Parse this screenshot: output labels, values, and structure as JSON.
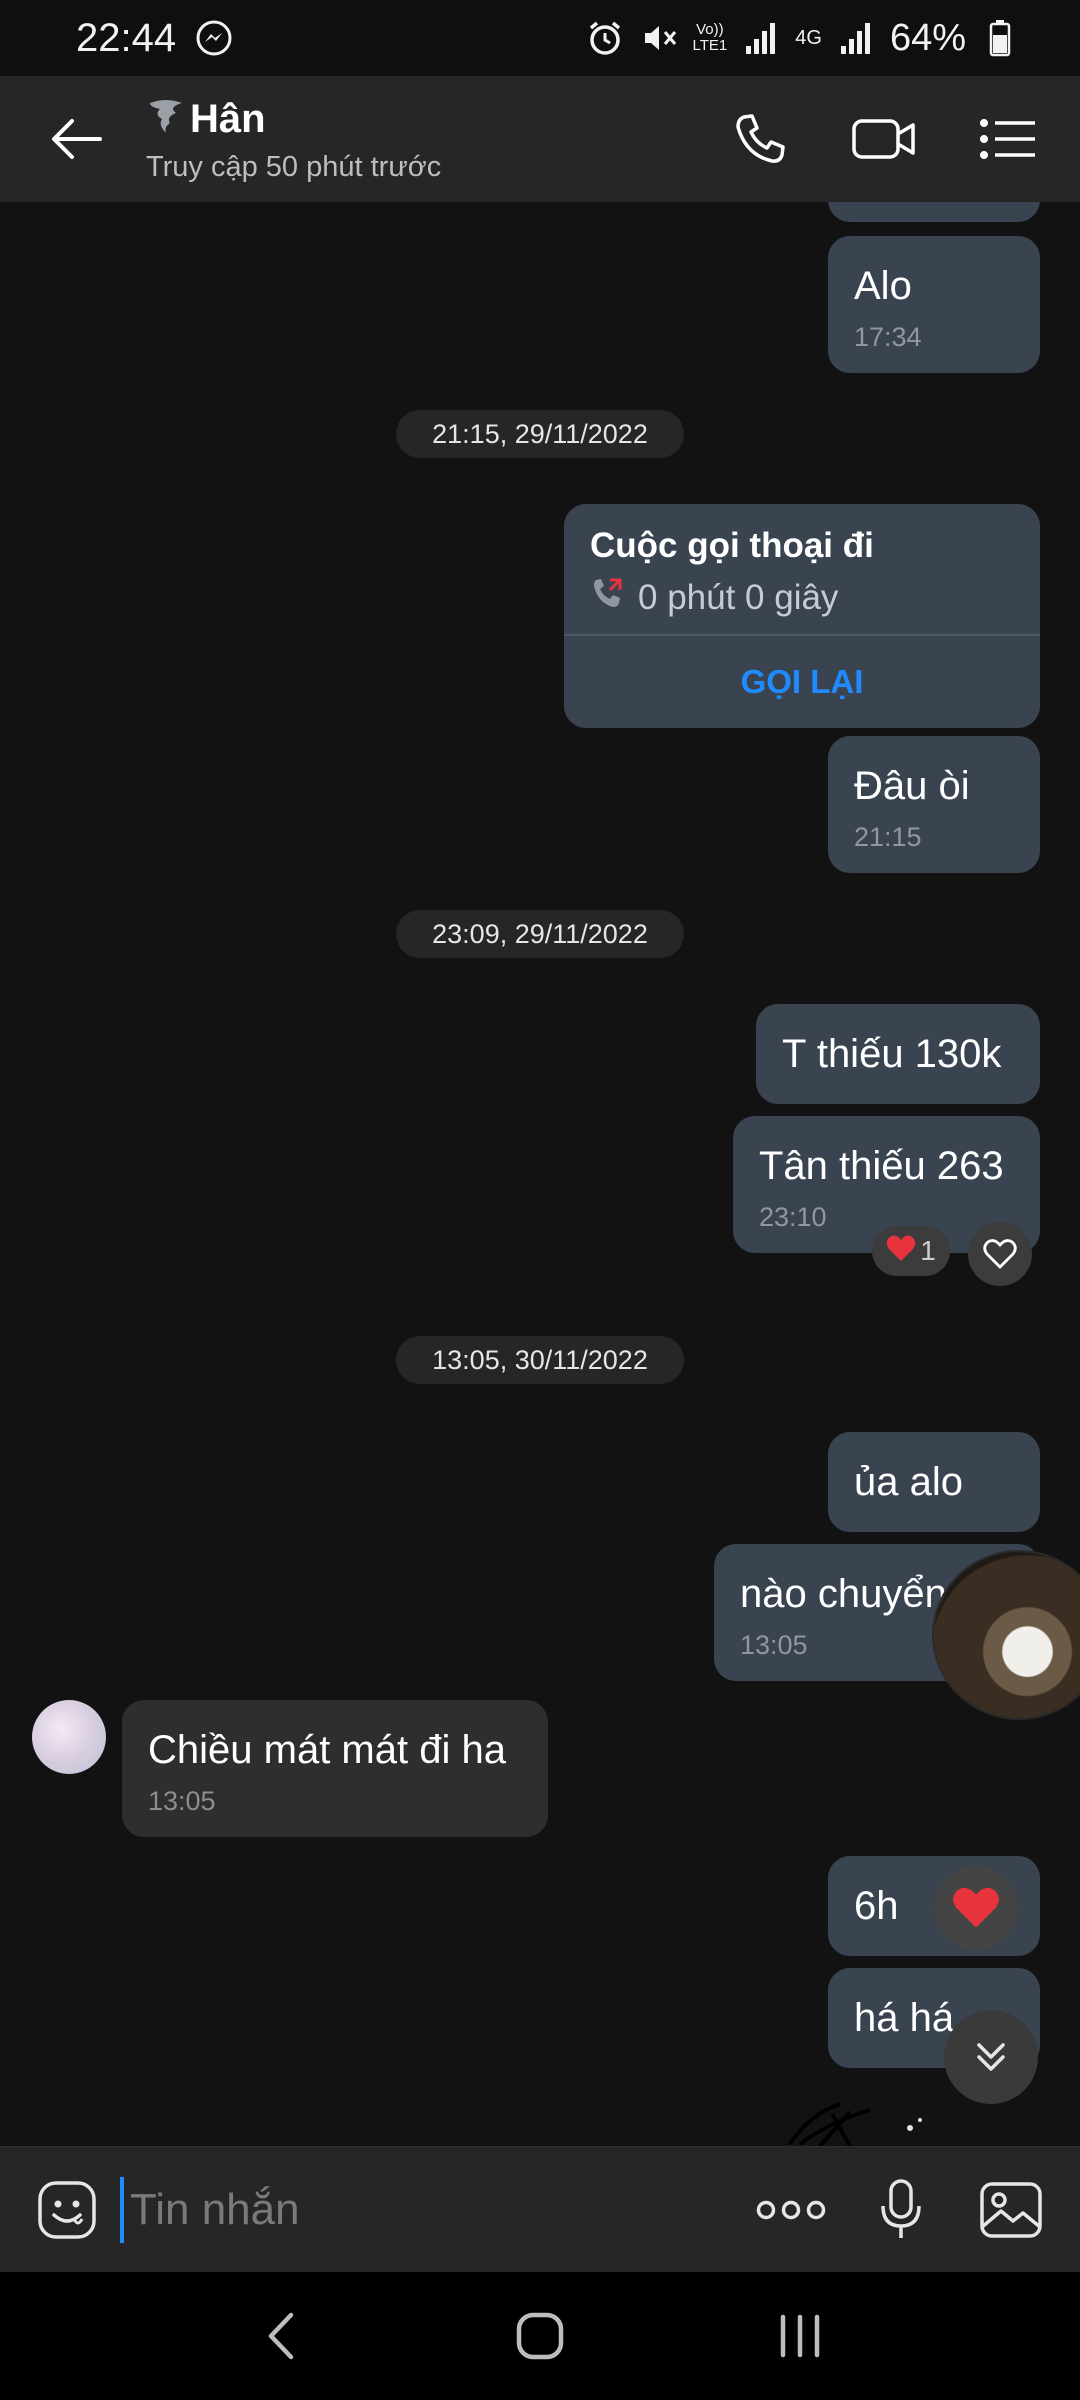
{
  "status_bar": {
    "time": "22:44",
    "volte_label_top": "Vo))",
    "volte_label_bottom": "LTE1",
    "net_4g": "4G",
    "battery": "64%"
  },
  "header": {
    "contact_name": "Hân",
    "last_seen": "Truy cập 50 phút trước"
  },
  "chat": {
    "messages": [
      {
        "text": "Alo",
        "time": "17:34"
      },
      {
        "date": "21:15, 29/11/2022"
      },
      {
        "call_title": "Cuộc gọi thoại đi",
        "call_duration": "0 phút 0 giây",
        "call_back": "GỌI LẠI"
      },
      {
        "text": "Đâu òi",
        "time": "21:15"
      },
      {
        "date": "23:09, 29/11/2022"
      },
      {
        "text": "T thiếu 130k"
      },
      {
        "text": "Tân thiếu 263",
        "time": "23:10",
        "reaction_count": "1"
      },
      {
        "date": "13:05, 30/11/2022"
      },
      {
        "text": "ủa alo"
      },
      {
        "text": "nào chuyển",
        "time": "13:05"
      },
      {
        "text": "Chiều mát mát đi ha",
        "time": "13:05"
      },
      {
        "text": "6h"
      },
      {
        "text": "há há"
      }
    ]
  },
  "composer": {
    "placeholder": "Tin nhắn"
  },
  "colors": {
    "background": "#121212",
    "outgoing_bubble": "#3a4350",
    "incoming_bubble": "#2e2e2e",
    "accent": "#1f8bff",
    "heart": "#e8323c"
  }
}
